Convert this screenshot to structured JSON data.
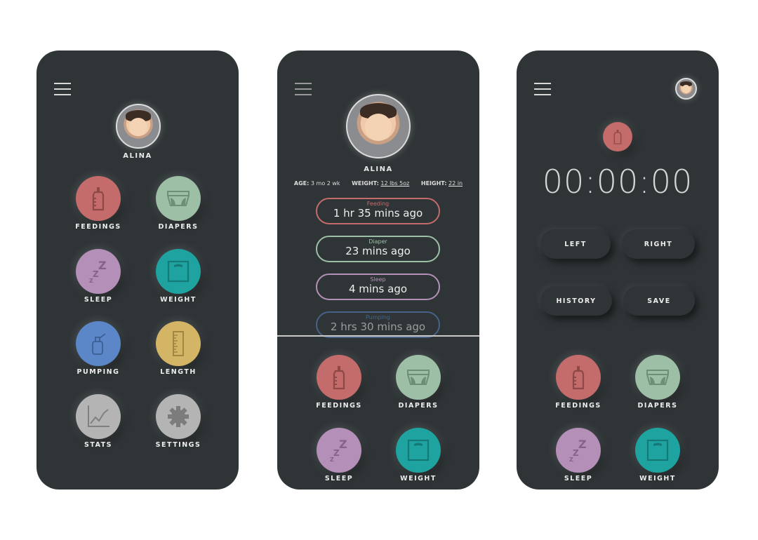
{
  "colors": {
    "background": "#2f3537",
    "feedings": "#c46b6b",
    "diapers": "#9cbfa5",
    "sleep": "#b48fb8",
    "weight": "#1fa3a0",
    "pumping": "#5b87c8",
    "length": "#d4b565",
    "stats": "#b4b4b4",
    "settings": "#b4b4b4"
  },
  "phone1": {
    "profile_name": "ALINA",
    "buttons": [
      {
        "key": "feedings",
        "label": "FEEDINGS",
        "icon": "baby-bottle-icon"
      },
      {
        "key": "diapers",
        "label": "DIAPERS",
        "icon": "diaper-icon"
      },
      {
        "key": "sleep",
        "label": "SLEEP",
        "icon": "zzz-icon"
      },
      {
        "key": "weight",
        "label": "WEIGHT",
        "icon": "scale-icon"
      },
      {
        "key": "pumping",
        "label": "PUMPING",
        "icon": "breast-pump-icon"
      },
      {
        "key": "length",
        "label": "LENGTH",
        "icon": "ruler-icon"
      },
      {
        "key": "stats",
        "label": "STATS",
        "icon": "chart-icon"
      },
      {
        "key": "settings",
        "label": "SETTINGS",
        "icon": "gear-icon"
      }
    ]
  },
  "phone2": {
    "profile_name": "ALINA",
    "age_label": "AGE:",
    "age": "3 mo 2 wk",
    "weight_label": "WEIGHT:",
    "weight": "12 lbs 5oz",
    "height_label": "HEIGHT:",
    "height": "22 in",
    "events": [
      {
        "key": "feedings",
        "title": "Feeding",
        "value": "1 hr 35 mins ago"
      },
      {
        "key": "diapers",
        "title": "Diaper",
        "value": "23 mins ago"
      },
      {
        "key": "sleep",
        "title": "Sleep",
        "value": "4 mins ago"
      },
      {
        "key": "pumping",
        "title": "Pumping",
        "value": "2 hrs 30 mins ago"
      }
    ],
    "buttons": [
      {
        "key": "feedings",
        "label": "FEEDINGS",
        "icon": "baby-bottle-icon"
      },
      {
        "key": "diapers",
        "label": "DIAPERS",
        "icon": "diaper-icon"
      },
      {
        "key": "sleep",
        "label": "SLEEP",
        "icon": "zzz-icon"
      },
      {
        "key": "weight",
        "label": "WEIGHT",
        "icon": "scale-icon"
      }
    ]
  },
  "phone3": {
    "timer": "00:00:00",
    "left": "LEFT",
    "right": "RIGHT",
    "history": "HISTORY",
    "save": "SAVE",
    "buttons": [
      {
        "key": "feedings",
        "label": "FEEDINGS",
        "icon": "baby-bottle-icon"
      },
      {
        "key": "diapers",
        "label": "DIAPERS",
        "icon": "diaper-icon"
      },
      {
        "key": "sleep",
        "label": "SLEEP",
        "icon": "zzz-icon"
      },
      {
        "key": "weight",
        "label": "WEIGHT",
        "icon": "scale-icon"
      }
    ]
  }
}
